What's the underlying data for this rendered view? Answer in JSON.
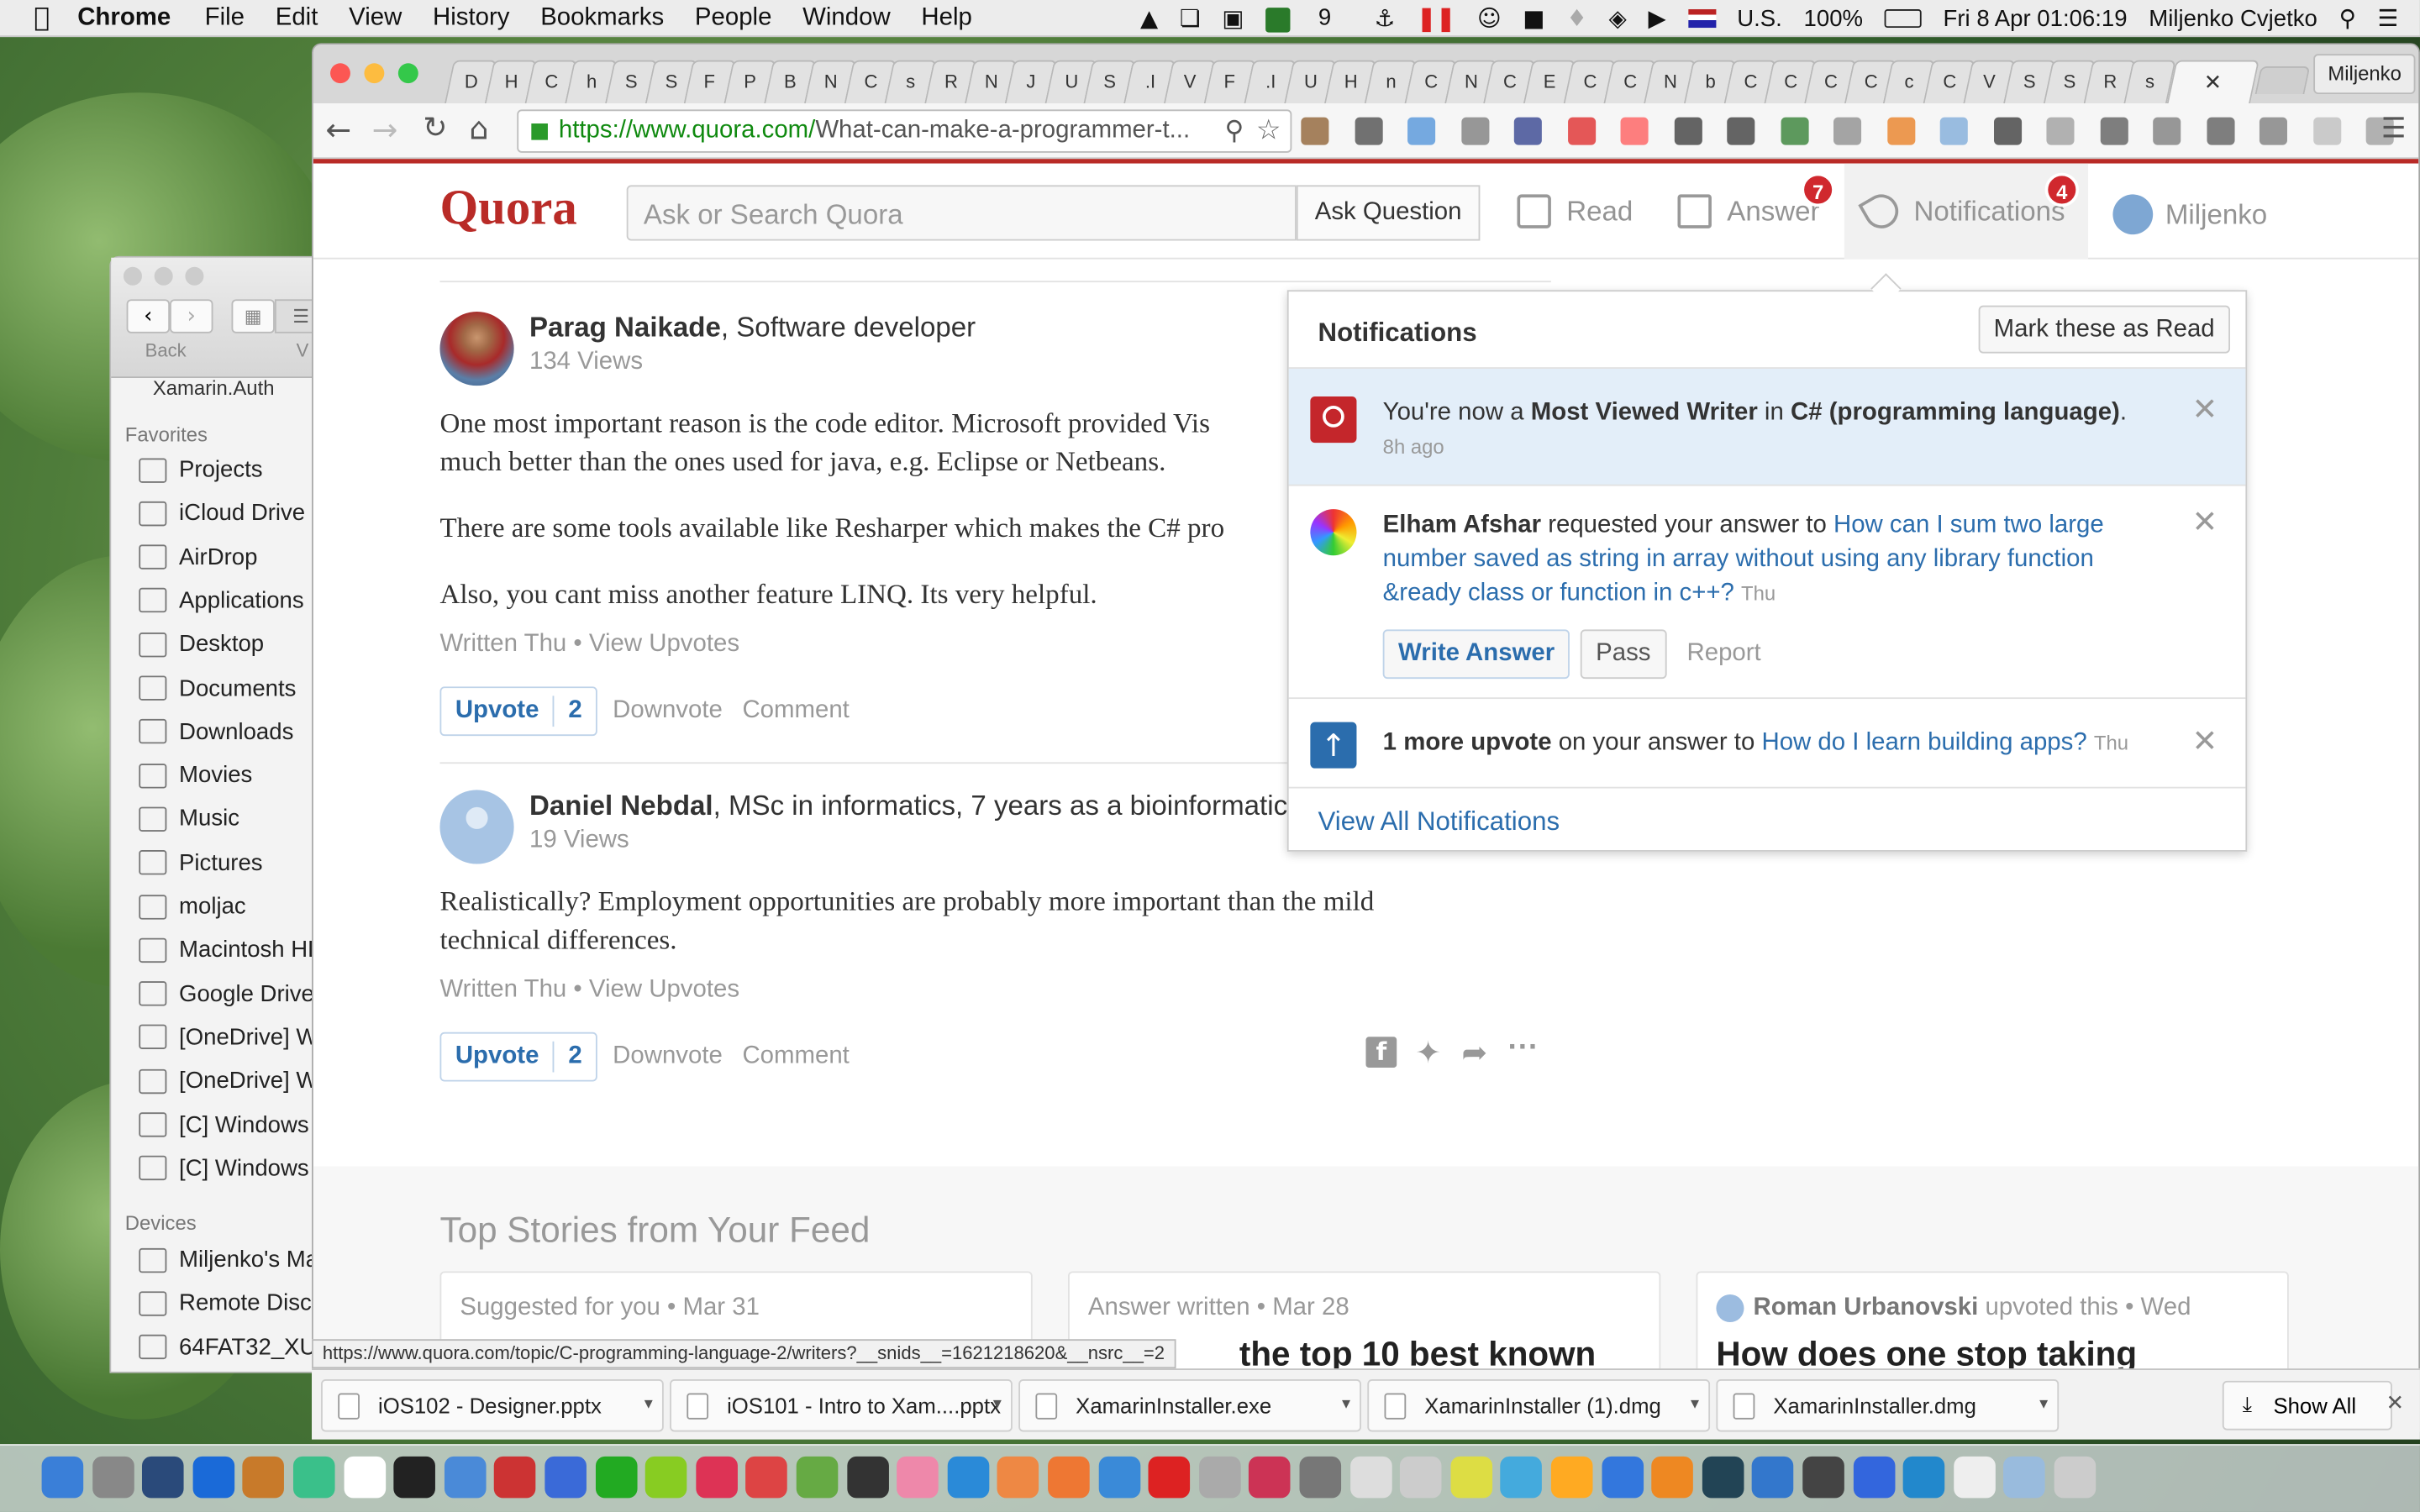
{
  "menubar": {
    "app": "Chrome",
    "menus": [
      "File",
      "Edit",
      "View",
      "History",
      "Bookmarks",
      "People",
      "Window",
      "Help"
    ],
    "badge_count": "9",
    "input_source": "U.S.",
    "battery": "100%",
    "datetime": "Fri 8 Apr  01:06:19",
    "user": "Miljenko Cvjetko"
  },
  "finder": {
    "back_label": "Back",
    "view_label": "V",
    "title": "Xamarin.Auth",
    "favorites_header": "Favorites",
    "favorites": [
      "Projects",
      "iCloud Drive",
      "AirDrop",
      "Applications",
      "Desktop",
      "Documents",
      "Downloads",
      "Movies",
      "Music",
      "Pictures",
      "moljac",
      "Macintosh HD",
      "Google Drive",
      "[OneDrive] W",
      "[OneDrive] W",
      "[C] Windows",
      "[C] Windows"
    ],
    "devices_header": "Devices",
    "devices": [
      "Miljenko's Ma",
      "Remote Disc",
      "64FAT32_XU"
    ]
  },
  "browser": {
    "profile": "Miljenko",
    "tab_letters": [
      "D",
      "H",
      "C",
      "h",
      "S",
      "S",
      "F",
      "P",
      "B",
      "N",
      "C",
      "s",
      "R",
      "N",
      "J",
      "U",
      "S",
      ".I",
      "V",
      "F",
      ".I",
      "U",
      "H",
      "n",
      "C",
      "N",
      "C",
      "E",
      "C",
      "C",
      "N",
      "b",
      "C",
      "C",
      "C",
      "C",
      "c",
      "C",
      "V",
      "S",
      "S",
      "R",
      "s"
    ],
    "url_prefix": "https://www.quora.com/",
    "url_rest": "What-can-make-a-programmer-t...",
    "status_url": "https://www.quora.com/topic/C-programming-language-2/writers?__snids__=1621218620&__nsrc__=2"
  },
  "quora": {
    "logo": "Quora",
    "search_placeholder": "Ask or Search Quora",
    "ask_button": "Ask Question",
    "nav": {
      "read": "Read",
      "answer": "Answer",
      "answer_badge": "7",
      "notifications": "Notifications",
      "notifications_badge": "4",
      "profile": "Miljenko"
    },
    "answers": [
      {
        "author": "Parag Naikade",
        "credential": ", Software developer",
        "views": "134 Views",
        "paragraphs": [
          "One most important reason is the code editor. Microsoft provided Vis",
          "much better than the ones used for java, e.g. Eclipse or Netbeans.",
          "There are some tools available like Resharper which makes the C# pro",
          "Also, you cant miss another feature LINQ. Its very helpful."
        ],
        "written": "Written Thu",
        "view_upvotes": "View Upvotes",
        "upvote": "Upvote",
        "upvote_count": "2",
        "downvote": "Downvote",
        "comment": "Comment"
      },
      {
        "author": "Daniel Nebdal",
        "credential": ", MSc in informatics, 7 years as a bioinformatic",
        "views": "19 Views",
        "paragraphs": [
          "Realistically? Employment opportunities are probably more important than the mild",
          "technical differences."
        ],
        "written": "Written Thu",
        "view_upvotes": "View Upvotes",
        "upvote": "Upvote",
        "upvote_count": "2",
        "downvote": "Downvote",
        "comment": "Comment"
      }
    ],
    "meta_separator": " • ",
    "notifications": {
      "title": "Notifications",
      "mark_read": "Mark these as Read",
      "items": [
        {
          "pre": "You're now a ",
          "bold1": "Most Viewed Writer",
          "mid": " in ",
          "bold2": "C# (programming language)",
          "post": ".",
          "time": "8h ago"
        },
        {
          "actor": "Elham Afshar",
          "text": " requested your answer to ",
          "link": "How can I sum two large number saved as string in array without using any library function &ready class or function in c++?",
          "time": "Thu",
          "write": "Write Answer",
          "pass": "Pass",
          "report": "Report"
        },
        {
          "bold": "1 more upvote",
          "text": " on your answer to ",
          "link": "How do I learn building apps?",
          "time": "Thu"
        }
      ],
      "view_all": "View All Notifications"
    },
    "top_stories": {
      "title": "Top Stories from Your Feed",
      "cards": [
        {
          "top": "Suggested for you • Mar 31",
          "headline": ""
        },
        {
          "top": "Answer written • Mar 28",
          "headline": "the top 10 best known"
        },
        {
          "top_bold": "Roman Urbanovski",
          "top": " upvoted this • Wed",
          "headline": "How does one stop taking"
        }
      ]
    }
  },
  "downloads": {
    "items": [
      "iOS102 - Designer.pptx",
      "iOS101 - Intro to Xam....pptx",
      "XamarinInstaller.exe",
      "XamarinInstaller (1).dmg",
      "XamarinInstaller.dmg"
    ],
    "show_all": "Show All"
  },
  "colors": {
    "quora_red": "#b92b27",
    "link_blue": "#2b6dad",
    "notif_highlight": "#e3eef9"
  }
}
